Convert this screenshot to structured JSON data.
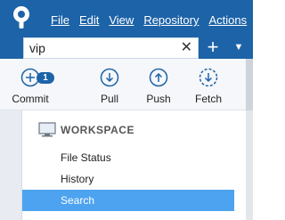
{
  "menu": {
    "file": "File",
    "edit": "Edit",
    "view": "View",
    "repository": "Repository",
    "actions": "Actions"
  },
  "search": {
    "value": "vip",
    "clear_glyph": "✕"
  },
  "header_buttons": {
    "add_glyph": "+",
    "dropdown_glyph": "▼"
  },
  "toolbar": {
    "commit_label": "Commit",
    "commit_badge": "1",
    "pull_label": "Pull",
    "push_label": "Push",
    "fetch_label": "Fetch"
  },
  "sidebar": {
    "workspace_label": "WORKSPACE",
    "items": [
      {
        "label": "File Status"
      },
      {
        "label": "History"
      },
      {
        "label": "Search"
      }
    ]
  },
  "colors": {
    "titlebar": "#1d63a7",
    "selected_item": "#4da3f0"
  },
  "icons": {
    "app_logo": "sourcetree-logo-icon",
    "commit": "plus-circle-icon",
    "pull": "arrow-down-circle-icon",
    "push": "arrow-up-circle-icon",
    "fetch": "dashed-arrow-down-circle-icon",
    "workspace": "monitor-icon"
  }
}
